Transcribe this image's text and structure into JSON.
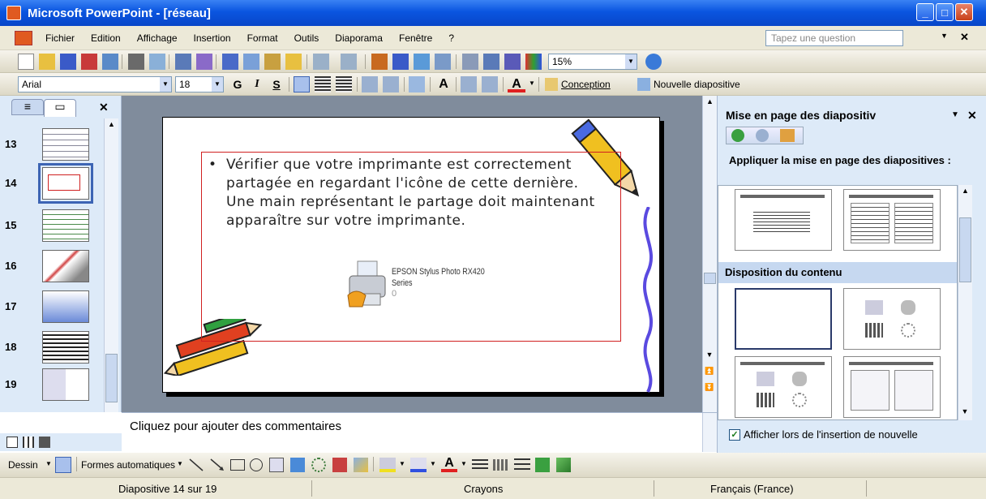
{
  "window": {
    "title": "Microsoft PowerPoint - [réseau]",
    "minimize_glyph": "_",
    "maximize_glyph": "□",
    "close_glyph": "✕"
  },
  "menu": {
    "items": [
      "Fichier",
      "Edition",
      "Affichage",
      "Insertion",
      "Format",
      "Outils",
      "Diaporama",
      "Fenêtre",
      "?"
    ],
    "ask_placeholder": "Tapez une question",
    "close_glyph": "✕"
  },
  "standard_toolbar": {
    "zoom": "15%"
  },
  "format_toolbar": {
    "font": "Arial",
    "size": "18",
    "bold": "G",
    "italic": "I",
    "shadow": "S",
    "grow": "A",
    "font_color": "A",
    "design_label": "Conception",
    "new_slide_label": "Nouvelle diapositive"
  },
  "slides_pane": {
    "thumbnails": [
      {
        "number": "13"
      },
      {
        "number": "14",
        "selected": true
      },
      {
        "number": "15"
      },
      {
        "number": "16"
      },
      {
        "number": "17"
      },
      {
        "number": "18"
      },
      {
        "number": "19"
      }
    ],
    "close_glyph": "✕"
  },
  "slide": {
    "bullet": "•",
    "text": "Vérifier que votre imprimante est correctement partagée en regardant l'icône de cette dernière. Une main représentant le partage doit maintenant apparaître sur votre imprimante.",
    "printer_name": "EPSON Stylus Photo RX420 Series",
    "printer_count": "0"
  },
  "notes": {
    "placeholder": "Cliquez pour ajouter des commentaires"
  },
  "task_pane": {
    "title": "Mise en page des diapositiv",
    "heading": "Appliquer la mise en page des diapositives :",
    "section": "Disposition du contenu",
    "checkbox_label": "Afficher lors de l'insertion de nouvelle",
    "checked": true,
    "close_glyph": "✕",
    "dropdown_glyph": "▼"
  },
  "drawing_toolbar": {
    "draw_label": "Dessin",
    "autoshapes_label": "Formes automatiques"
  },
  "statusbar": {
    "slide_info": "Diapositive 14 sur 19",
    "design": "Crayons",
    "language": "Français (France)"
  },
  "colors": {
    "title_blue": "#0a55e0",
    "slide_border_red": "#d02020",
    "pane_bg": "#ddeaf8"
  }
}
